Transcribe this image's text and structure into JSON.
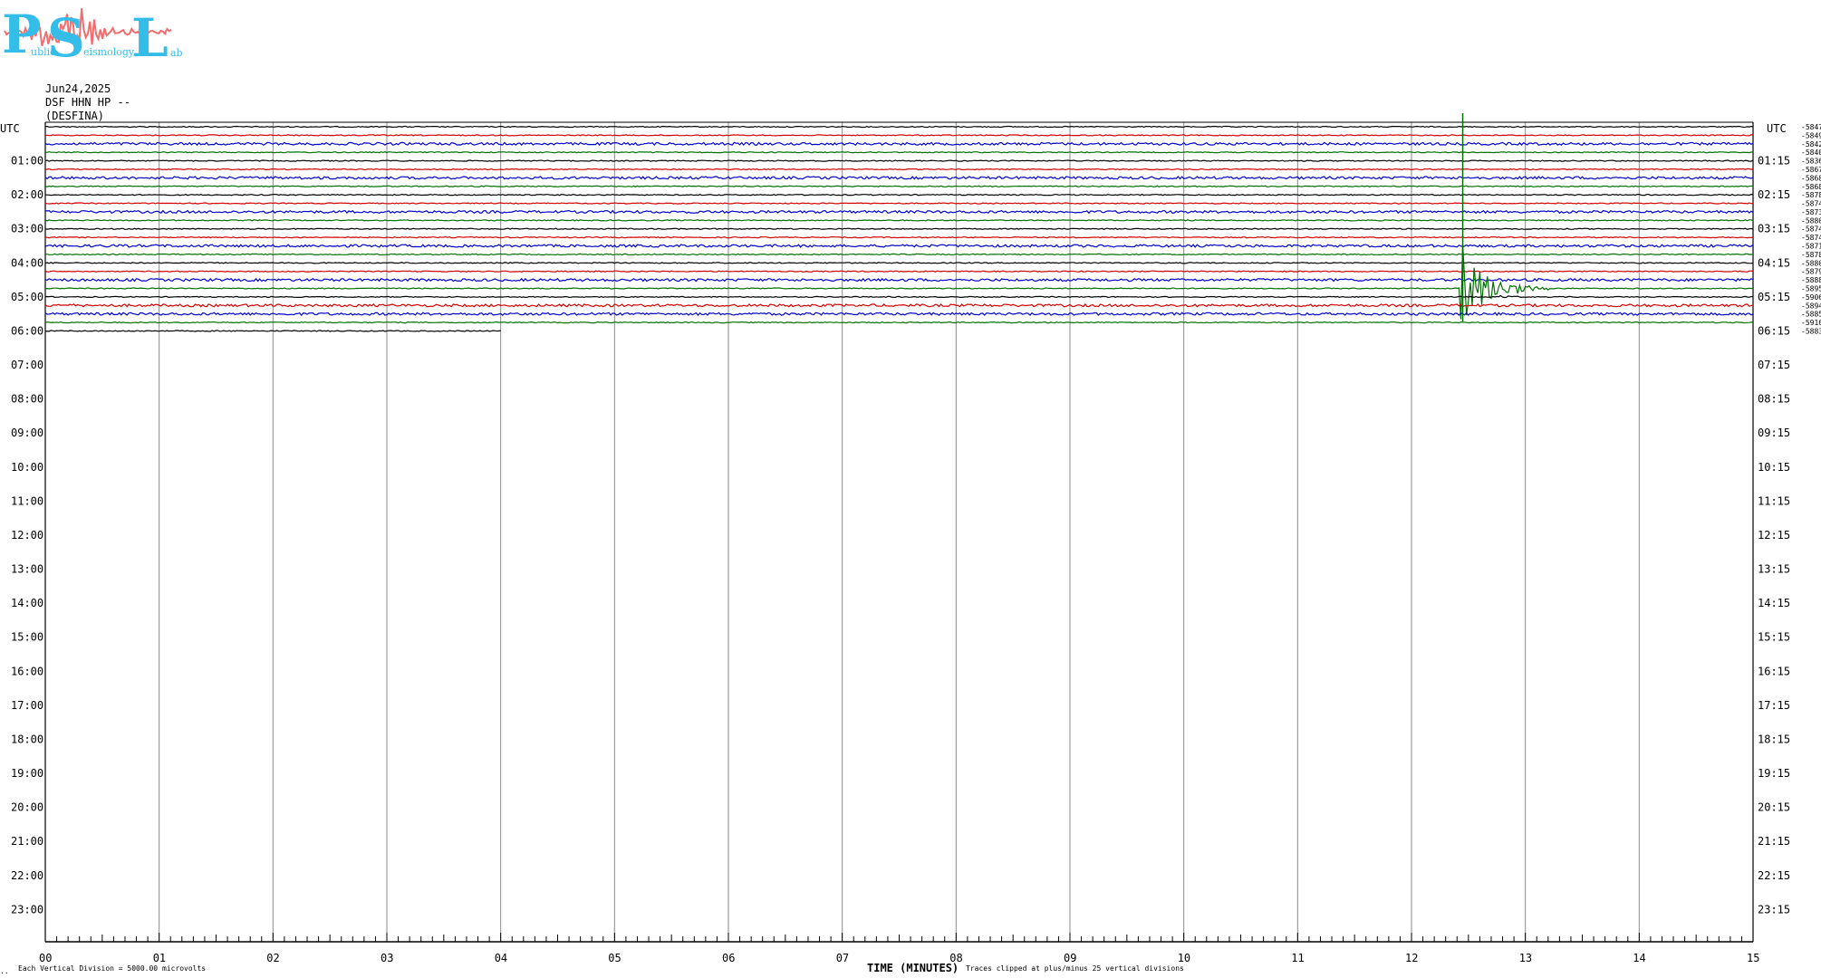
{
  "logo": {
    "letters": [
      "P",
      "S",
      "L"
    ],
    "words": [
      "ublic",
      "eismology",
      "ab"
    ],
    "colors": {
      "text": "#33bde8",
      "wave": "#f26d6d"
    }
  },
  "header": {
    "date": "Jun24,2025",
    "channel": "DSF HHN HP --",
    "station": "(DESFINA)"
  },
  "chart_data": {
    "type": "helicorder",
    "left_axis_title": "UTC",
    "right_axis_title": "UTC",
    "left_hours": [
      "01:00",
      "02:00",
      "03:00",
      "04:00",
      "05:00",
      "06:00",
      "07:00",
      "08:00",
      "09:00",
      "10:00",
      "11:00",
      "12:00",
      "13:00",
      "14:00",
      "15:00",
      "16:00",
      "17:00",
      "18:00",
      "19:00",
      "20:00",
      "21:00",
      "22:00",
      "23:00"
    ],
    "right_hours": [
      "01:15",
      "02:15",
      "03:15",
      "04:15",
      "05:15",
      "06:15",
      "07:15",
      "08:15",
      "09:15",
      "10:15",
      "11:15",
      "12:15",
      "13:15",
      "14:15",
      "15:15",
      "16:15",
      "17:15",
      "18:15",
      "19:15",
      "20:15",
      "21:15",
      "22:15",
      "23:15"
    ],
    "x_ticks": [
      "00",
      "01",
      "02",
      "03",
      "04",
      "05",
      "06",
      "07",
      "08",
      "09",
      "10",
      "11",
      "12",
      "13",
      "14",
      "15"
    ],
    "x_range": [
      0,
      15
    ],
    "xlabel": "TIME (MINUTES)",
    "minutes_per_line": 15,
    "lines_per_hour": 4,
    "total_hour_slots": 24,
    "line_colors": [
      "#000000",
      "#d40000",
      "#0000cc",
      "#007000"
    ],
    "recorded_lines": 25,
    "last_line_end_minute": 4,
    "offsets": [
      "-5847",
      "-5849",
      "-5842",
      "-5840",
      "-5836",
      "-5867",
      "-5868",
      "-5868",
      "-5878",
      "-5874",
      "-5873",
      "-5880",
      "-5874",
      "-5874",
      "-5871",
      "-5878",
      "-5880",
      "-5879",
      "-5888",
      "-5895",
      "-5906",
      "-5894",
      "-5885",
      "-5916",
      "-5883"
    ],
    "events": [
      {
        "line": 19,
        "minute": 12.45,
        "duration_min": 0.8,
        "amplitude": 1.0
      },
      {
        "line": 20,
        "minute": 12.8,
        "duration_min": 0.3,
        "amplitude": 0.05
      }
    ],
    "clip_divisions": 25,
    "footer_left": "Each Vertical Division = 5000.00 microvolts",
    "footer_right": "Traces clipped at plus/minus 25 vertical divisions",
    "corner_mark": "..",
    "grid": true
  }
}
